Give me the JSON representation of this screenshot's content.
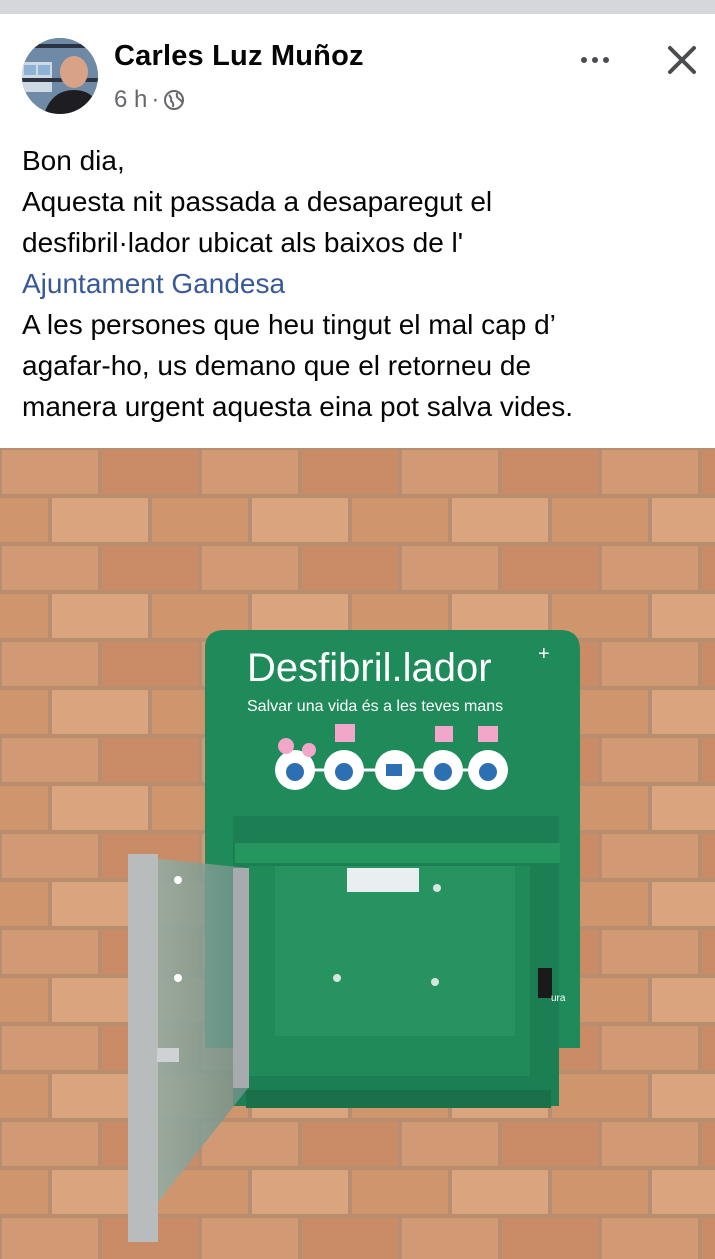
{
  "post": {
    "author": "Carles Luz Muñoz",
    "time": "6 h",
    "separator": "·",
    "privacy_icon": "globe-icon",
    "more_icon": "more-options-icon",
    "close_icon": "close-icon",
    "text_lines": [
      "Bon dia,",
      "Aquesta nit passada a desaparegut el",
      "desfibril·lador ubicat als baixos de l'",
      "A les persones que heu tingut el mal cap d’",
      "agafar-ho, us demano que el retorneu de",
      "manera urgent aquesta eina pot salva vides."
    ],
    "mention": "Ajuntament Gandesa"
  },
  "photo": {
    "sign_title": "Desfibril.lador",
    "sign_subtitle": "Salvar una vida és a les teves mans",
    "cabinet_color": "#1f8a5a",
    "wall_color": "#c98f66",
    "door_label": "ura"
  },
  "colors": {
    "link": "#385898",
    "meta": "#65676b",
    "text": "#050505"
  }
}
